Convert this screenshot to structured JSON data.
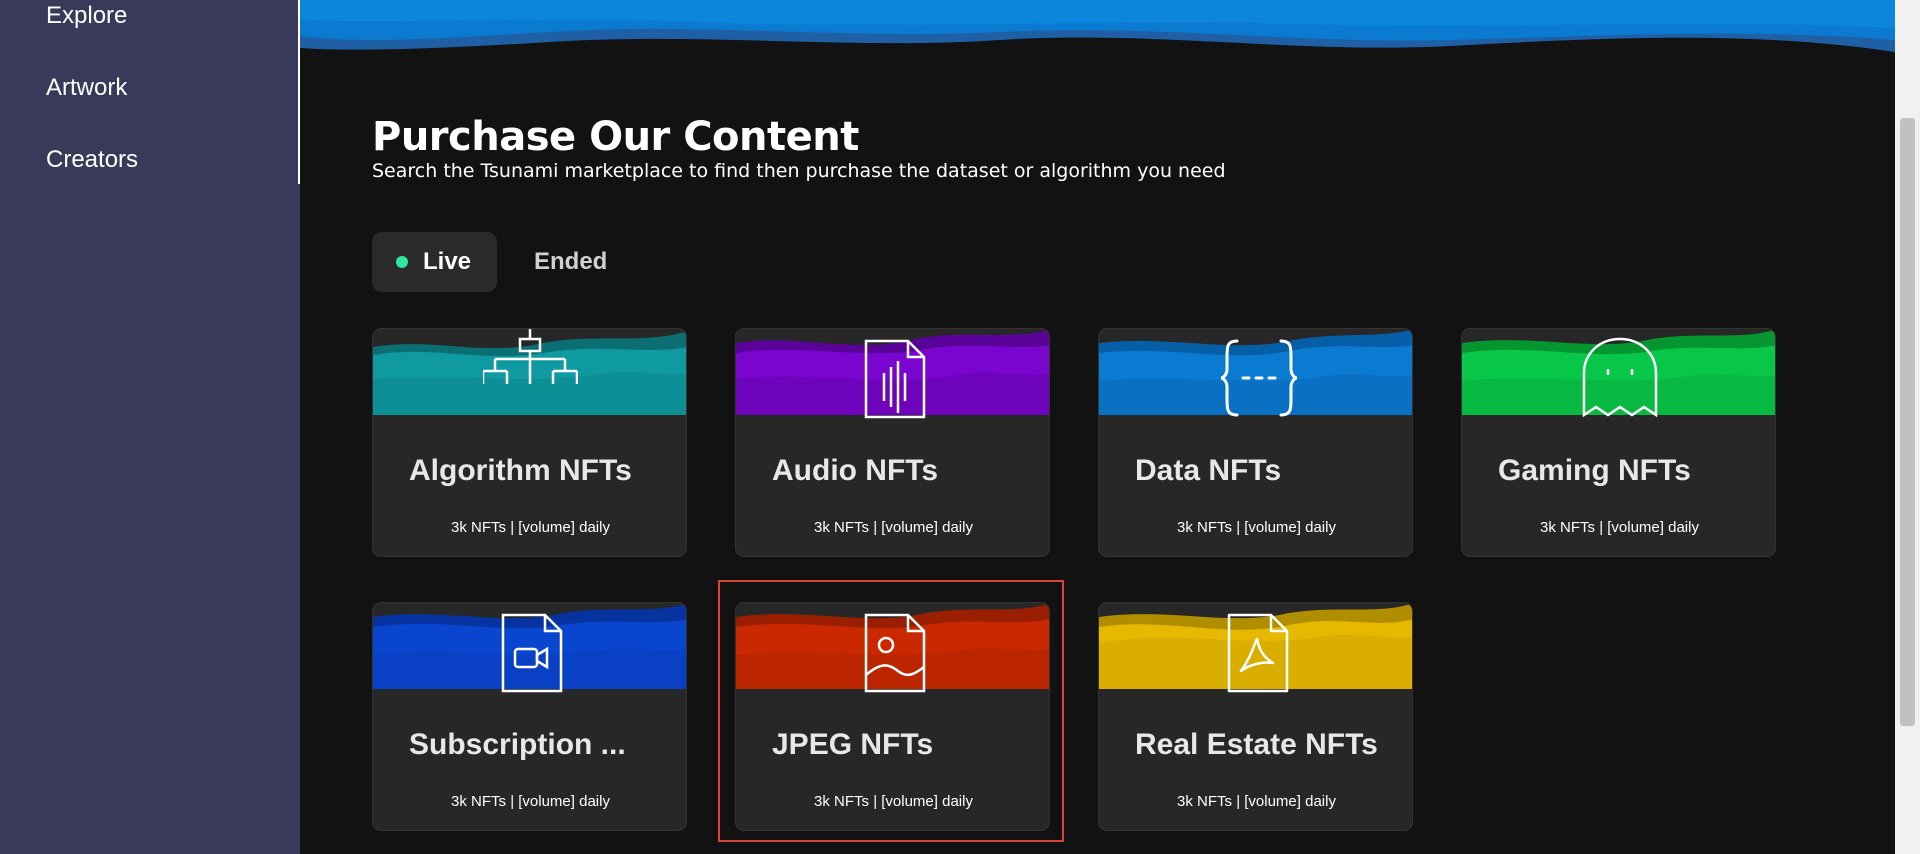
{
  "sidebar": {
    "items": [
      {
        "label": "Explore"
      },
      {
        "label": "Artwork"
      },
      {
        "label": "Creators"
      }
    ]
  },
  "main": {
    "title": "Purchase Our Content",
    "subtitle": "Search the Tsunami marketplace to find then purchase the dataset or algorithm you need",
    "tabs": [
      {
        "label": "Live",
        "active": true
      },
      {
        "label": "Ended",
        "active": false
      }
    ],
    "cards": [
      {
        "title": "Algorithm NFTs",
        "stats": "3k NFTs | [volume] daily",
        "color": "#0e9aa0",
        "icon": "algorithm-tree-icon"
      },
      {
        "title": "Audio NFTs",
        "stats": "3k NFTs | [volume] daily",
        "color": "#7a05cf",
        "icon": "audio-file-icon"
      },
      {
        "title": "Data NFTs",
        "stats": "3k NFTs | [volume] daily",
        "color": "#0a7bd0",
        "icon": "curly-braces-icon"
      },
      {
        "title": "Gaming NFTs",
        "stats": "3k NFTs | [volume] daily",
        "color": "#08c648",
        "icon": "ghost-icon"
      },
      {
        "title": "Subscription ...",
        "stats": "3k NFTs | [volume] daily",
        "color": "#0a45d0",
        "icon": "video-file-icon"
      },
      {
        "title": "JPEG NFTs",
        "stats": "3k NFTs | [volume] daily",
        "color": "#c92800",
        "icon": "image-file-icon"
      },
      {
        "title": "Real Estate NFTs",
        "stats": "3k NFTs | [volume] daily",
        "color": "#e6b800",
        "icon": "pdf-file-icon"
      }
    ]
  },
  "colors": {
    "sidebar_bg": "#393a5a",
    "page_bg": "#121212",
    "card_bg": "#272727",
    "live_dot": "#2ee8a0",
    "highlight": "#d9443a",
    "banner": "#0a7bd0"
  }
}
